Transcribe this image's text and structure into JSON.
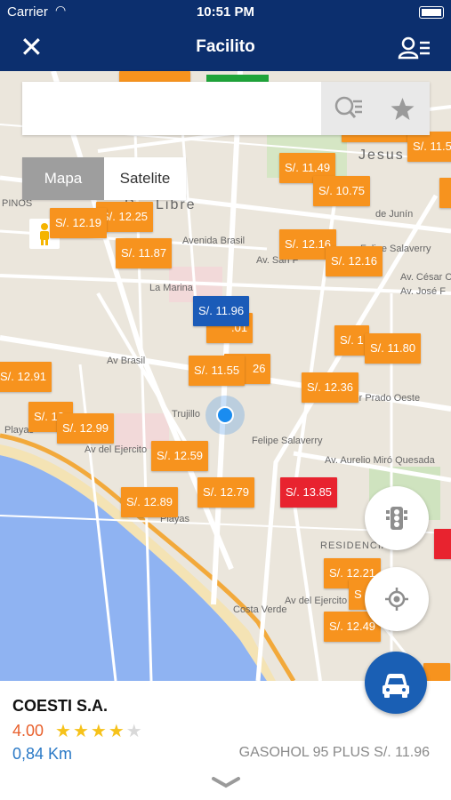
{
  "status": {
    "carrier": "Carrier",
    "time": "10:51 PM"
  },
  "nav": {
    "title": "Facilito"
  },
  "search": {
    "placeholder": ""
  },
  "map_type": {
    "map": "Mapa",
    "satellite": "Satelite",
    "selected": "Mapa"
  },
  "map_labels": [
    "Jesus",
    "PINOS",
    "P",
    "Libre",
    "de Junín",
    "Felipe Salaverry",
    "Av. San F",
    "Av. César Ca",
    "Av. José F",
    "La Marina",
    "Avenida Brasil",
    "Av Brasil",
    "Av. Javier Prado Oeste",
    "Av del Ejercito",
    "Trujillo",
    "Felipe Salaverry",
    "Av. Aurelio Miró Quesada",
    "RESIDENCIAL",
    "Av del Ejercito",
    "Costa Verde",
    "Playas",
    "Playas"
  ],
  "markers": [
    {
      "price": "S/. 11.49",
      "color": "orange"
    },
    {
      "price": "S/. 10.75",
      "color": "orange"
    },
    {
      "price": "S/. 12.19",
      "color": "orange"
    },
    {
      "price": "S/. 12.25",
      "color": "orange"
    },
    {
      "price": "S/. 11.87",
      "color": "orange"
    },
    {
      "price": "S/. 12.16",
      "color": "orange"
    },
    {
      "price": "S/. 12.16",
      "color": "orange"
    },
    {
      "price": "S/. 11.96",
      "color": "blue"
    },
    {
      "price": "S/. 11.55",
      "color": "orange"
    },
    {
      "price": "26",
      "color": "orange"
    },
    {
      "price": "S/. 12.36",
      "color": "orange"
    },
    {
      "price": "S/. 11.80",
      "color": "orange"
    },
    {
      "price": "S/. 12.91",
      "color": "orange"
    },
    {
      "price": "S/. 12.99",
      "color": "orange"
    },
    {
      "price": "S/. 12.59",
      "color": "orange"
    },
    {
      "price": "S/. 12.89",
      "color": "orange"
    },
    {
      "price": "S/. 12.79",
      "color": "orange"
    },
    {
      "price": "S/. 13.85",
      "color": "red"
    },
    {
      "price": "S/. 12.21",
      "color": "orange"
    },
    {
      "price": "S/. 12.49",
      "color": "orange"
    },
    {
      "price": "S/. 11.5",
      "color": "orange"
    },
    {
      "price": "S/. 1",
      "color": "orange"
    },
    {
      "price": "S/. 12.",
      "color": "orange"
    },
    {
      "price": ".01",
      "color": "orange"
    },
    {
      "price": "S",
      "color": "orange"
    }
  ],
  "station": {
    "name": "COESTI S.A.",
    "rating": "4.00",
    "stars_filled": 4,
    "stars_total": 5,
    "distance": "0,84 Km",
    "fuel": "GASOHOL 95 PLUS S/. 11.96"
  },
  "colors": {
    "nav": "#0c2f6e",
    "marker": "#f7931e",
    "marker_selected": "#1b5bb8",
    "marker_expensive": "#e8232f",
    "fab": "#1a5fb4"
  }
}
